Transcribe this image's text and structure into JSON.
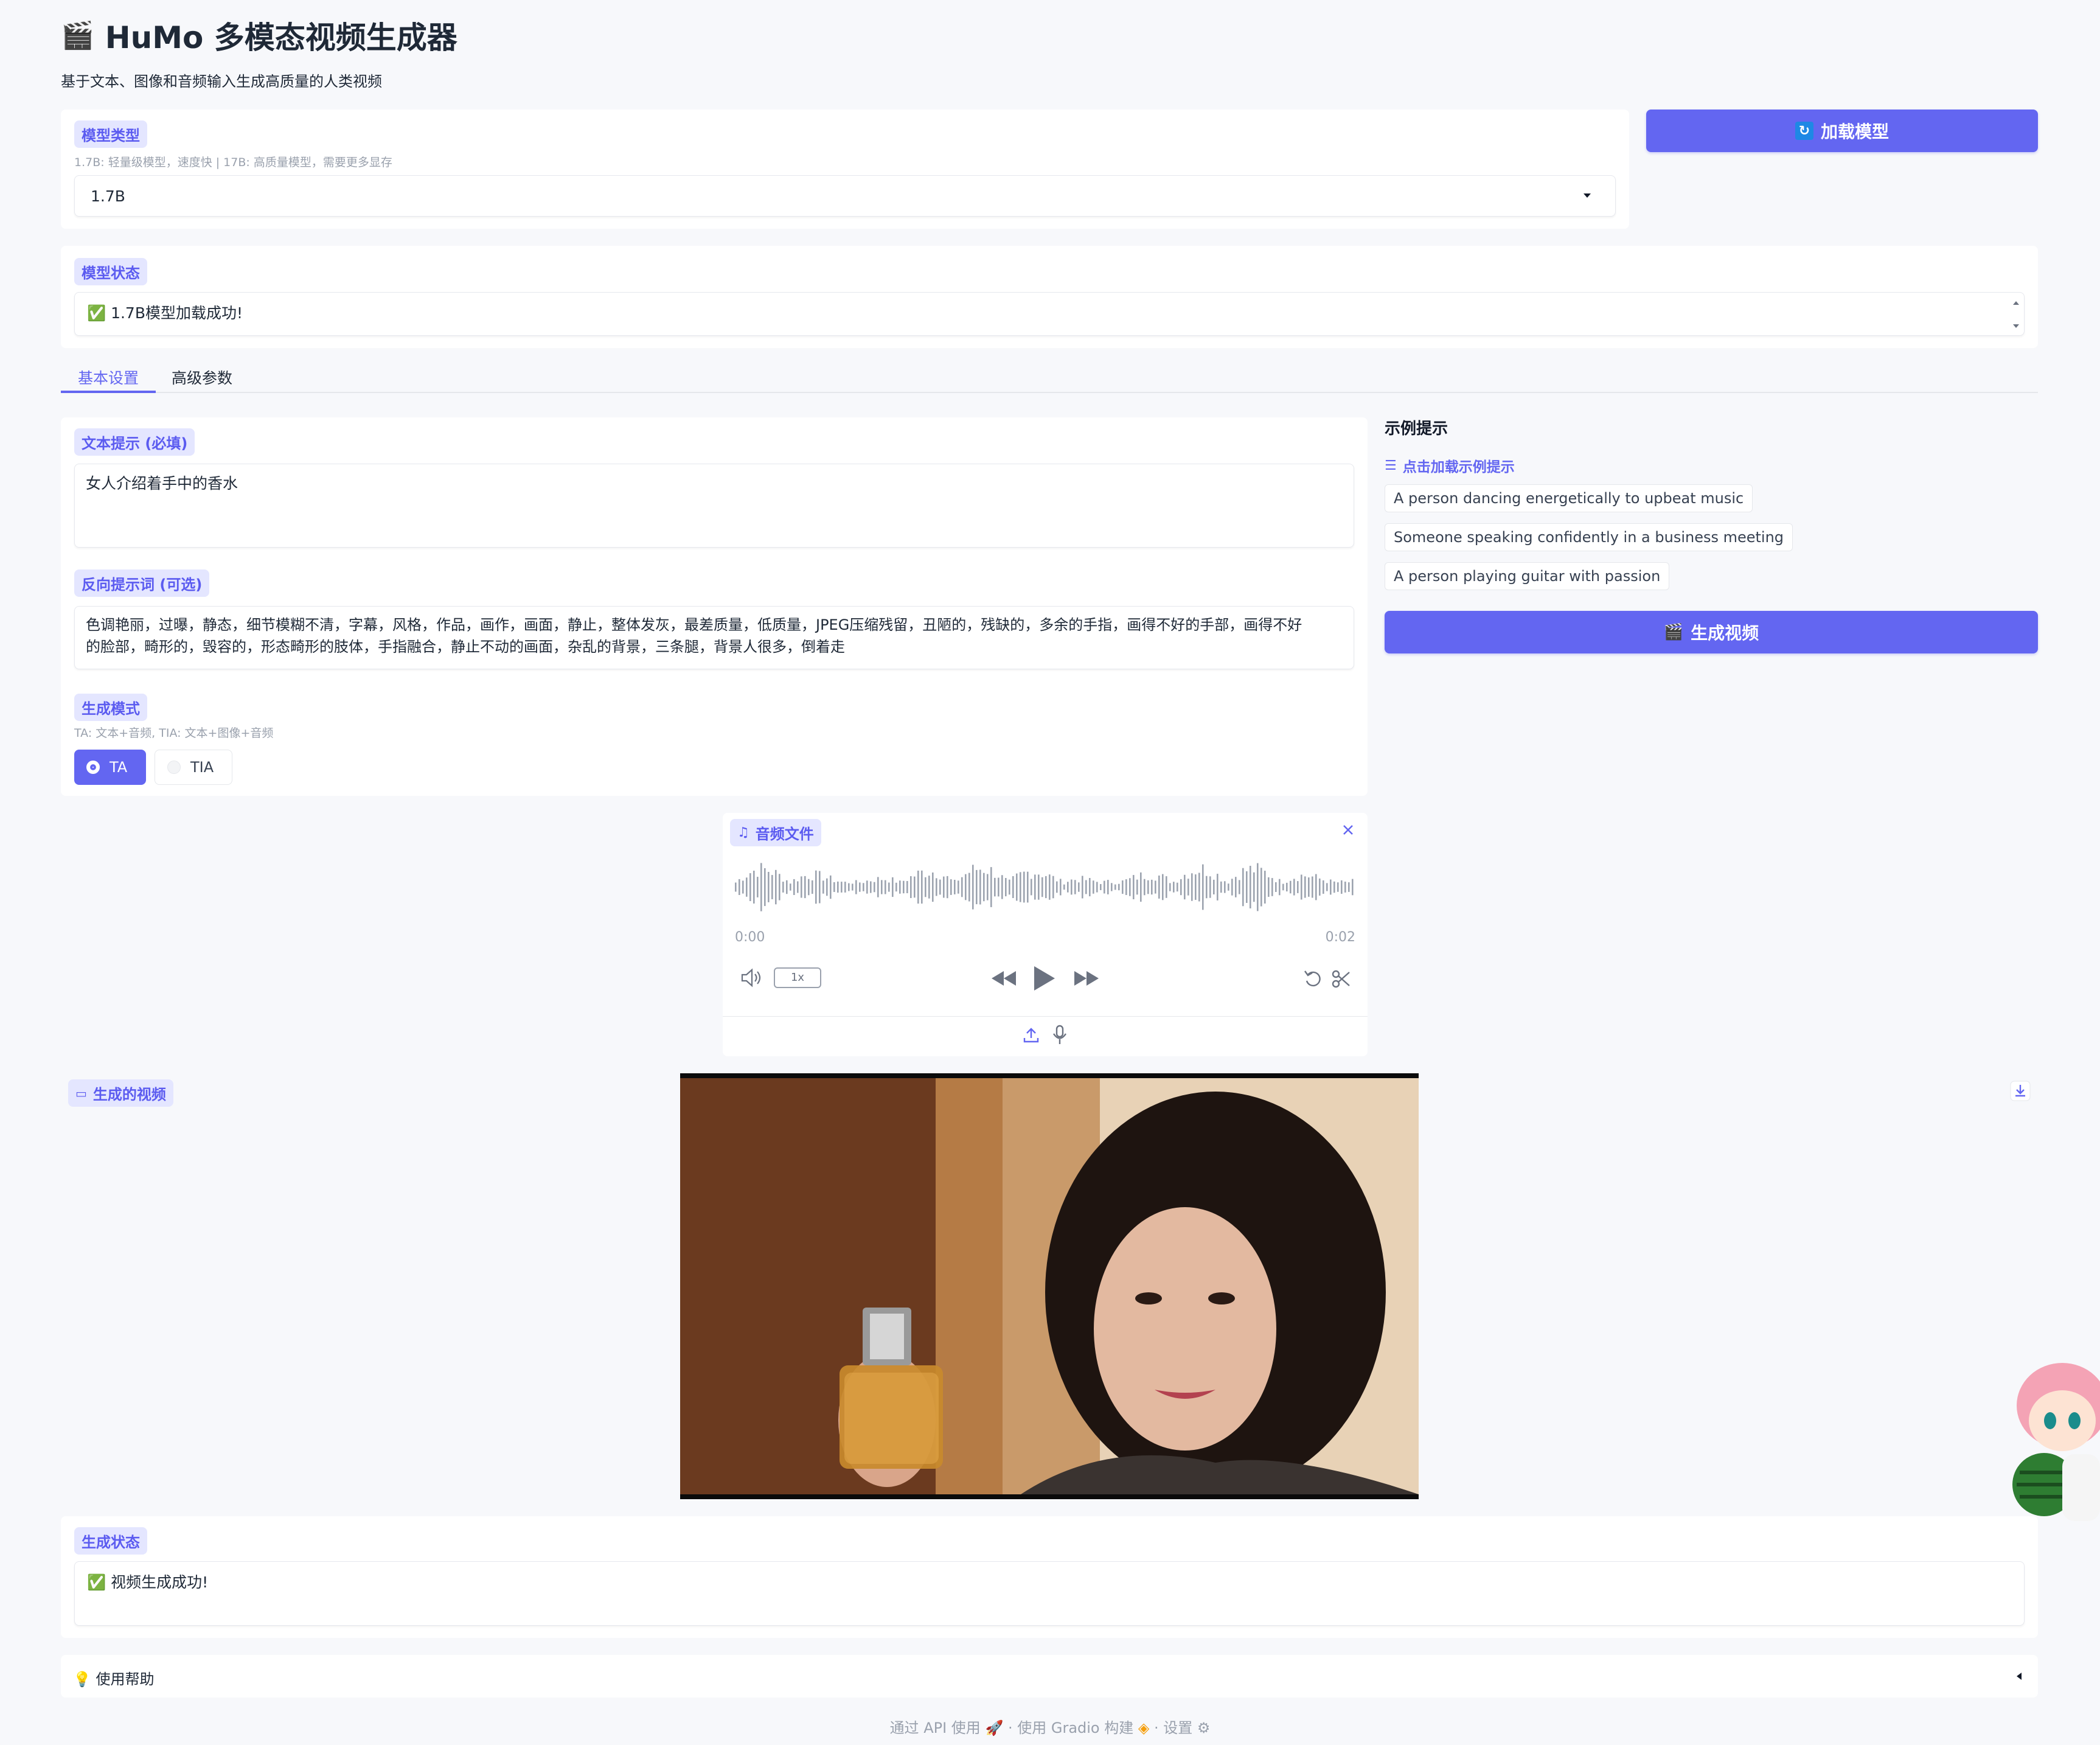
{
  "header": {
    "icon": "clapper-icon",
    "title": "HuMo 多模态视频生成器",
    "subtitle": "基于文本、图像和音频输入生成高质量的人类视频"
  },
  "model_type": {
    "label": "模型类型",
    "info": "1.7B: 轻量级模型，速度快 | 17B: 高质量模型，需要更多显存",
    "selected": "1.7B"
  },
  "load_button": {
    "icon": "refresh-icon",
    "label": "加载模型"
  },
  "model_status": {
    "label": "模型状态",
    "value": "✅ 1.7B模型加载成功!"
  },
  "tabs": [
    "基本设置",
    "高级参数"
  ],
  "text_prompt": {
    "label": "文本提示 (必填)",
    "value": "女人介绍着手中的香水"
  },
  "negative_prompt": {
    "label": "反向提示词 (可选)",
    "value_line1": "色调艳丽，过曝，静态，细节模糊不清，字幕，风格，作品，画作，画面，静止，整体发灰，最差质量，低质量，JPEG压缩残留，丑陋的，残缺的，多余的手指，画得不好的手部，画得不好",
    "value_line2": "的脸部，畸形的，毁容的，形态畸形的肢体，手指融合，静止不动的画面，杂乱的背景，三条腿，背景人很多，倒着走"
  },
  "generation_mode": {
    "label": "生成模式",
    "info": "TA: 文本+音频, TIA: 文本+图像+音频",
    "options": [
      "TA",
      "TIA"
    ],
    "selected": "TA"
  },
  "examples": {
    "title": "示例提示",
    "dataset_label": "点击加载示例提示",
    "items": [
      "A person dancing energetically to upbeat music",
      "Someone speaking confidently in a business meeting",
      "A person playing guitar with passion"
    ]
  },
  "generate_button": {
    "icon": "clapper-icon",
    "label": "生成视频"
  },
  "audio": {
    "label": "音频文件",
    "time_start": "0:00",
    "time_end": "0:02",
    "speed": "1x"
  },
  "video": {
    "label": "生成的视频"
  },
  "gen_status": {
    "label": "生成状态",
    "value": "✅ 视频生成成功!"
  },
  "help": {
    "label": "💡 使用帮助"
  },
  "footer": {
    "api": "通过 API 使用",
    "built": "使用 Gradio 构建",
    "settings": "设置",
    "separator": "·"
  },
  "colors": {
    "accent": "#6366f1",
    "badge_bg": "#e4e6ff",
    "page_bg": "#f7f8fb"
  }
}
